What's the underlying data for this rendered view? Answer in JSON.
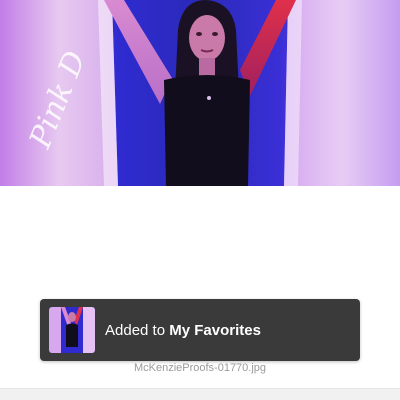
{
  "photo": {
    "watermark_text": "Pink D"
  },
  "toast": {
    "prefix": "Added to",
    "collection": "My Favorites"
  },
  "file": {
    "name": "McKenzieProofs-01770.jpg"
  },
  "colors": {
    "toast_background": "#3a3a3a",
    "backdrop_blue": "#2b2ac9",
    "curtain_pink": "#f1c6ea",
    "filename_text": "#9a9a9a"
  }
}
